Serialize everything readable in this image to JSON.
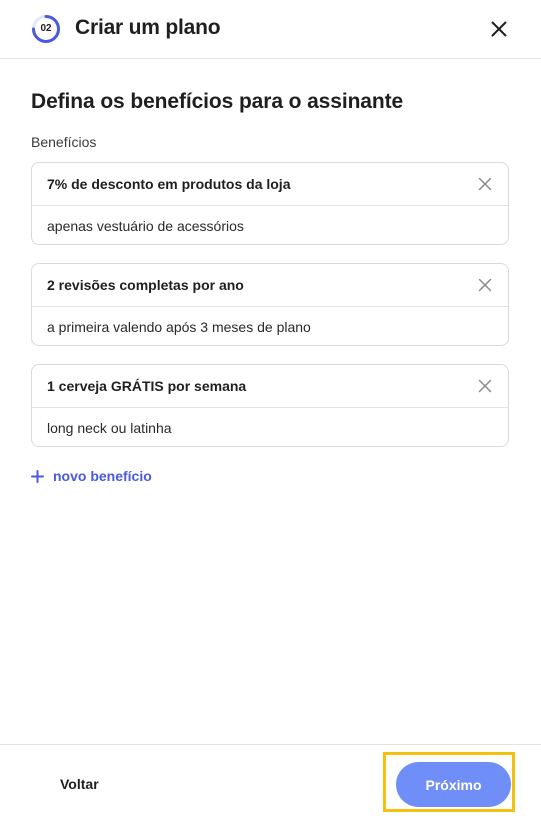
{
  "header": {
    "step": "02",
    "title": "Criar um plano"
  },
  "main": {
    "heading": "Defina os benefícios para o assinante",
    "section_label": "Benefícios",
    "benefits": [
      {
        "title": "7% de desconto em produtos da loja",
        "description": "apenas vestuário de acessórios"
      },
      {
        "title": "2 revisões completas por ano",
        "description": "a primeira valendo após 3 meses de plano"
      },
      {
        "title": "1 cerveja GRÁTIS por semana",
        "description": "long neck ou latinha"
      }
    ],
    "add_benefit_label": "novo benefício"
  },
  "footer": {
    "back_label": "Voltar",
    "next_label": "Próximo"
  },
  "colors": {
    "accent": "#4a5ae0",
    "primary_button": "#6f8ef7",
    "highlight": "#f2c20f"
  }
}
